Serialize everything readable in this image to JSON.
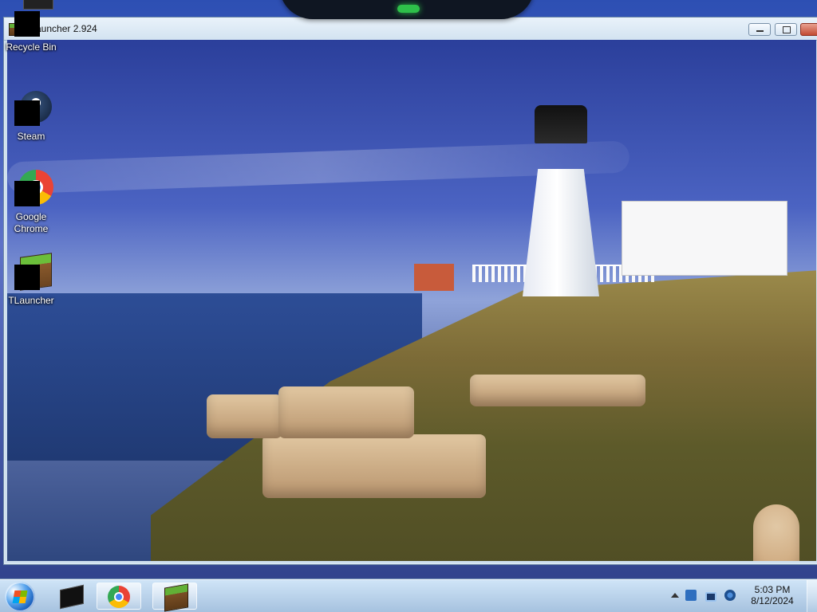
{
  "desktop": {
    "icons": [
      {
        "label": "Recycle Bin",
        "icon": "recycle-bin-icon"
      },
      {
        "label": "Steam",
        "icon": "steam-icon"
      },
      {
        "label": "Google Chrome",
        "icon": "chrome-icon"
      },
      {
        "label": "TLauncher",
        "icon": "tlauncher-icon"
      }
    ]
  },
  "window": {
    "title": "TLauncher 2.924",
    "controls": {
      "minimize": "minimize-icon",
      "maximize": "maximize-icon",
      "close": "close-icon"
    },
    "content_icon": "landscape-wallpaper"
  },
  "taskbar": {
    "start": "windows-start-icon",
    "apps": [
      {
        "name": "steam",
        "icon": "steam-icon"
      },
      {
        "name": "chrome",
        "icon": "chrome-icon"
      },
      {
        "name": "tlauncher",
        "icon": "tlauncher-icon"
      }
    ],
    "tray": {
      "time": "5:03 PM",
      "date": "8/12/2024",
      "icons": [
        "up-arrow-icon",
        "shield-icon",
        "monitor-icon",
        "network-icon"
      ]
    }
  },
  "colors": {
    "accent": "#1459b8",
    "taskbar": "#a6c2df",
    "titlebar": "#d3e3f1"
  }
}
